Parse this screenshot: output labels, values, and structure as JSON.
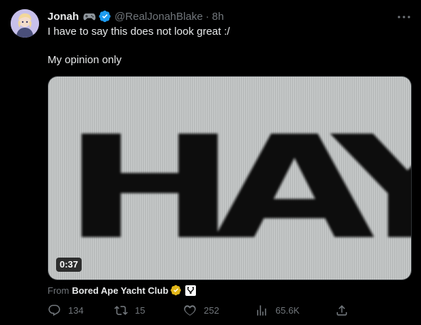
{
  "author": {
    "name": "Jonah",
    "handle": "@RealJonahBlake",
    "separator": "·",
    "time": "8h"
  },
  "tweet": {
    "lines": [
      "I have to say this does not look great :/",
      "My opinion only"
    ]
  },
  "media": {
    "duration": "0:37",
    "video_title": "HAY"
  },
  "attribution": {
    "from_label": "From",
    "account": "Bored Ape Yacht Club"
  },
  "actions": {
    "replies": "134",
    "retweets": "15",
    "likes": "252",
    "views": "65.6K"
  },
  "colors": {
    "background": "#000000",
    "text": "#e7e9ea",
    "muted": "#71767b",
    "verified_blue": "#1d9bf0",
    "verified_gold": "#e2b719"
  },
  "icons": {
    "emoji": "game-controller-icon",
    "verified": "verified-badge-icon",
    "more": "more-dots-icon",
    "reply": "reply-icon",
    "retweet": "retweet-icon",
    "like": "heart-icon",
    "views": "views-icon",
    "share": "share-icon"
  }
}
